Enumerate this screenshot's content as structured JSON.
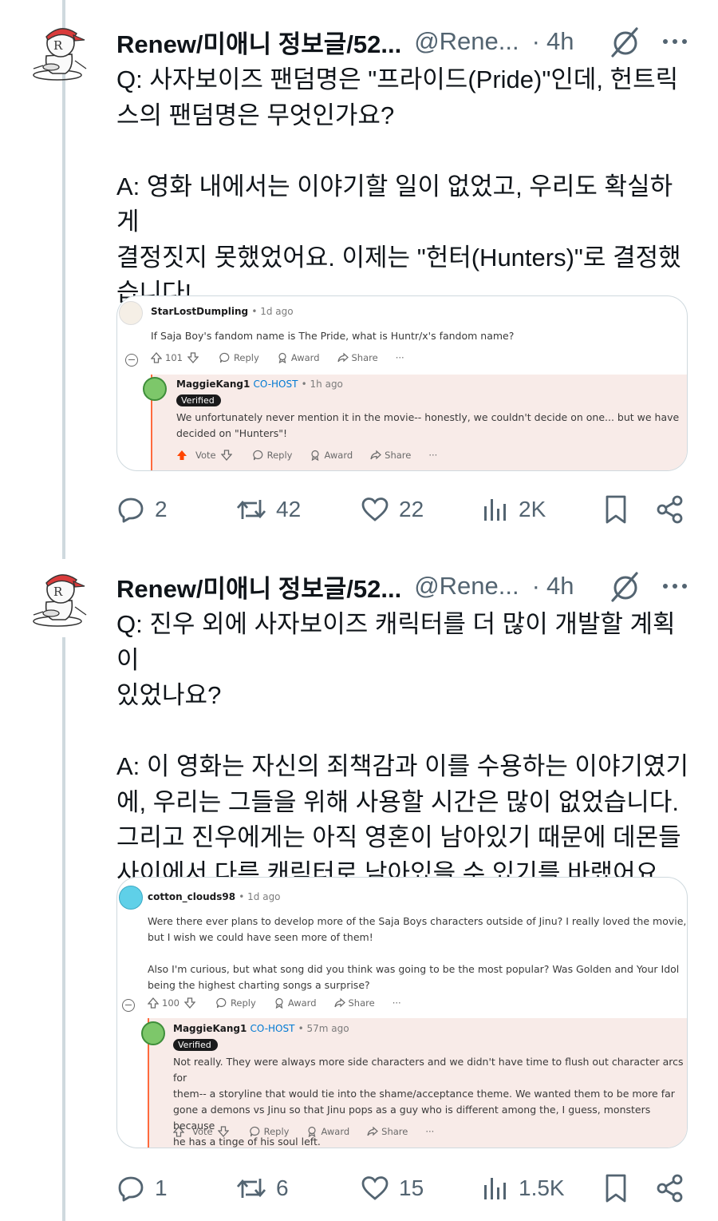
{
  "tweets": [
    {
      "author": {
        "name": "Renew/미애니 정보글/52...",
        "handle": "@Rene...",
        "separator": "·",
        "time": "4h"
      },
      "text": "Q: 사자보이즈 팬덤명은 \"프라이드(Pride)\"인데, 헌트릭\n스의 팬덤명은 무엇인가요?\n\nA: 영화 내에서는 이야기할 일이 없었고, 우리도 확실하게\n결정짓지 못했었어요. 이제는 \"헌터(Hunters)\"로 결정했\n습니다!",
      "embed": {
        "comment": {
          "user": "StarLostDumpling",
          "meta": "• 1d ago",
          "text": "If Saja Boy's fandom name is The Pride, what is Huntr/x's fandom name?",
          "votes": "101",
          "reply_label": "Reply",
          "award_label": "Award",
          "share_label": "Share",
          "more_label": "···"
        },
        "reply": {
          "user": "MaggieKang1",
          "host": "CO-HOST",
          "meta": "• 1h ago",
          "badge": "Verified",
          "text": "We unfortunately never mention it in the movie-- honestly, we couldn't decide on one... but we have\ndecided on \"Hunters\"!",
          "vote_label": "Vote",
          "reply_label": "Reply",
          "award_label": "Award",
          "share_label": "Share",
          "more_label": "···"
        }
      },
      "actions": {
        "replies": "2",
        "reposts": "42",
        "likes": "22",
        "views": "2K"
      }
    },
    {
      "author": {
        "name": "Renew/미애니 정보글/52...",
        "handle": "@Rene...",
        "separator": "·",
        "time": "4h"
      },
      "text": "Q: 진우 외에 사자보이즈 캐릭터를 더 많이 개발할 계획이\n있었나요?\n\nA: 이 영화는 자신의 죄책감과 이를 수용하는 이야기였기\n에, 우리는 그들을 위해 사용할 시간은 많이 없었습니다.\n그리고 진우에게는 아직 영혼이 남아있기 때문에 데몬들\n사이에서 다른 캐릭터로 남아있을 수 있기를 바랬어요.",
      "embed": {
        "comment": {
          "user": "cotton_clouds98",
          "meta": "• 1d ago",
          "text": "Were there ever plans to develop more of the Saja Boys characters outside of Jinu? I really loved the movie,\nbut I wish we could have seen more of them!\n\nAlso I'm curious, but what song did you think was going to be the most popular? Was Golden and Your Idol\nbeing the highest charting songs a surprise?",
          "votes": "100",
          "reply_label": "Reply",
          "award_label": "Award",
          "share_label": "Share",
          "more_label": "···"
        },
        "reply": {
          "user": "MaggieKang1",
          "host": "CO-HOST",
          "meta": "• 57m ago",
          "badge": "Verified",
          "text": "Not really. They were always more side characters and we didn't have time to flush out character arcs for\nthem-- a storyline that would tie into the shame/acceptance theme. We wanted them to be more far\ngone a demons vs Jinu so that Jinu pops as a guy who is different among the, I guess, monsters because\nhe has a tinge of his soul left.",
          "vote_label": "Vote",
          "reply_label": "Reply",
          "award_label": "Award",
          "share_label": "Share",
          "more_label": "···"
        }
      },
      "actions": {
        "replies": "1",
        "reposts": "6",
        "likes": "15",
        "views": "1.5K"
      }
    }
  ],
  "colors": {
    "text": "#0f1419",
    "secondary": "#536471",
    "thread_line": "#cfd9de",
    "reddit_upvote": "#ff4500",
    "reddit_host": "#0079d3",
    "reply_bg": "#f8ebe8"
  },
  "icons": [
    "reply-icon",
    "repost-icon",
    "like-icon",
    "views-icon",
    "bookmark-icon",
    "share-icon",
    "grok-icon",
    "more-icon"
  ]
}
